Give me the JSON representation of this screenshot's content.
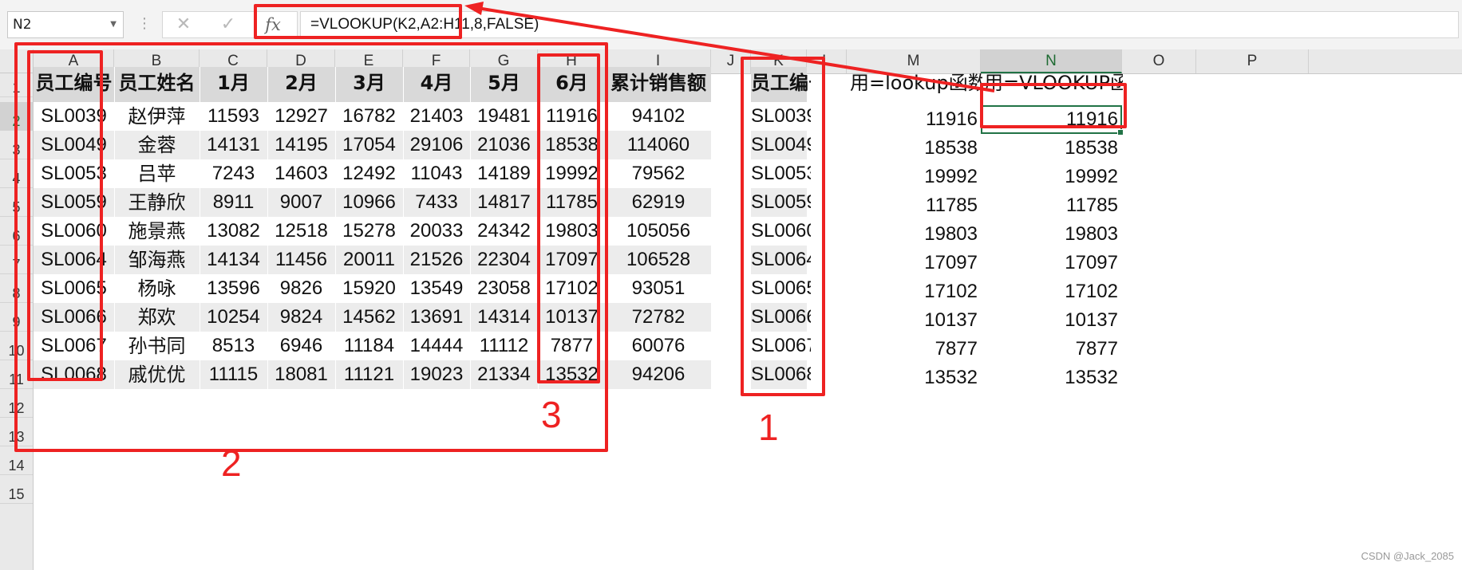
{
  "formula_bar": {
    "name_box": "N2",
    "formula": "=VLOOKUP(K2,A2:H11,8,FALSE)"
  },
  "columns": [
    "A",
    "B",
    "C",
    "D",
    "E",
    "F",
    "G",
    "H",
    "I",
    "J",
    "K",
    "L",
    "M",
    "N",
    "O",
    "P"
  ],
  "rows": [
    "1",
    "2",
    "3",
    "4",
    "5",
    "6",
    "7",
    "8",
    "9",
    "10",
    "11",
    "12",
    "13",
    "14",
    "15"
  ],
  "selected": {
    "cell": "N2",
    "column": "N",
    "row": "2"
  },
  "table": {
    "headers": [
      "员工编号",
      "员工姓名",
      "1月",
      "2月",
      "3月",
      "4月",
      "5月",
      "6月",
      "累计销售额"
    ],
    "rows": [
      [
        "SL0039",
        "赵伊萍",
        "11593",
        "12927",
        "16782",
        "21403",
        "19481",
        "11916",
        "94102"
      ],
      [
        "SL0049",
        "金蓉",
        "14131",
        "14195",
        "17054",
        "29106",
        "21036",
        "18538",
        "114060"
      ],
      [
        "SL0053",
        "吕苹",
        "7243",
        "14603",
        "12492",
        "11043",
        "14189",
        "19992",
        "79562"
      ],
      [
        "SL0059",
        "王静欣",
        "8911",
        "9007",
        "10966",
        "7433",
        "14817",
        "11785",
        "62919"
      ],
      [
        "SL0060",
        "施景燕",
        "13082",
        "12518",
        "15278",
        "20033",
        "24342",
        "19803",
        "105056"
      ],
      [
        "SL0064",
        "邹海燕",
        "14134",
        "11456",
        "20011",
        "21526",
        "22304",
        "17097",
        "106528"
      ],
      [
        "SL0065",
        "杨咏",
        "13596",
        "9826",
        "15920",
        "13549",
        "23058",
        "17102",
        "93051"
      ],
      [
        "SL0066",
        "郑欢",
        "10254",
        "9824",
        "14562",
        "13691",
        "14314",
        "10137",
        "72782"
      ],
      [
        "SL0067",
        "孙书同",
        "8513",
        "6946",
        "11184",
        "14444",
        "11112",
        "7877",
        "60076"
      ],
      [
        "SL0068",
        "戚优优",
        "11115",
        "18081",
        "11121",
        "19023",
        "21334",
        "13532",
        "94206"
      ]
    ]
  },
  "lookup": {
    "k_header": "员工编号",
    "m_header": "用=lookup函数",
    "n_header": "用=VLOOKUP函数",
    "ids": [
      "SL0039",
      "SL0049",
      "SL0053",
      "SL0059",
      "SL0060",
      "SL0064",
      "SL0065",
      "SL0066",
      "SL0067",
      "SL0068"
    ],
    "m_values": [
      "11916",
      "18538",
      "19992",
      "11785",
      "19803",
      "17097",
      "17102",
      "10137",
      "7877",
      "13532"
    ],
    "n_values": [
      "11916",
      "18538",
      "19992",
      "11785",
      "19803",
      "17097",
      "17102",
      "10137",
      "7877",
      "13532"
    ]
  },
  "annotations": {
    "label_1": "1",
    "label_2": "2",
    "label_3": "3",
    "color": "#ee2222"
  },
  "watermark": "CSDN @Jack_2085",
  "colors": {
    "header_band": "#d9d9d9",
    "stripe_band": "#ececec",
    "selection": "#217346"
  }
}
